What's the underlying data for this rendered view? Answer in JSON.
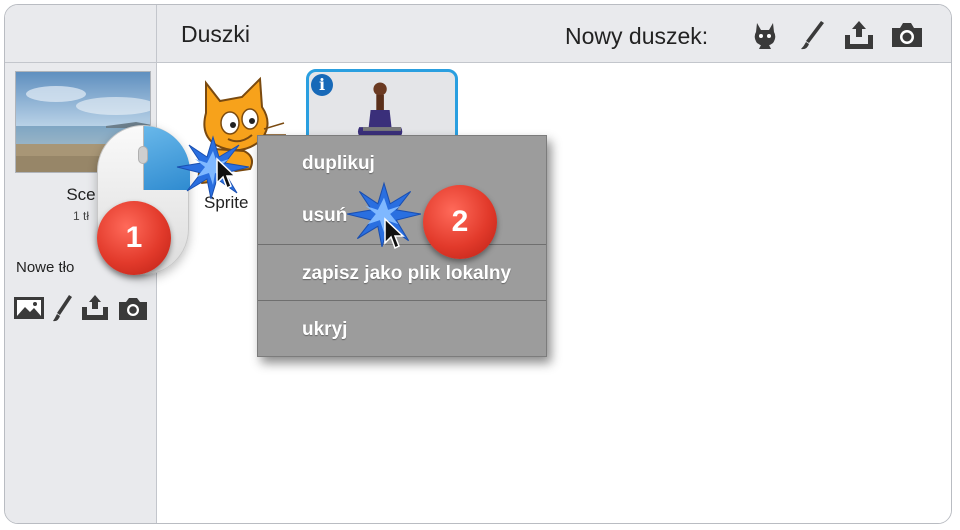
{
  "header": {
    "title": "Duszki",
    "new_sprite_label": "Nowy duszek:",
    "icons": [
      "choose-sprite-from-library-icon",
      "paint-new-sprite-icon",
      "upload-sprite-icon",
      "camera-icon"
    ]
  },
  "stage": {
    "name": "Sce",
    "sub": "1 tł",
    "new_backdrop_label": "Nowe tło",
    "icons": [
      "choose-backdrop-icon",
      "paint-backdrop-icon",
      "upload-backdrop-icon",
      "camera-backdrop-icon"
    ]
  },
  "sprites": [
    {
      "label": "Sprite",
      "icon": "scratch-cat-sprite",
      "selected": false
    },
    {
      "label": "",
      "icon": "person-sprite",
      "selected": true,
      "info": "i"
    }
  ],
  "context_menu": {
    "items": [
      "duplikuj",
      "usuń",
      "zapisz jako plik lokalny",
      "ukryj"
    ]
  },
  "annotations": {
    "step1": "1",
    "step2": "2"
  },
  "colors": {
    "accent": "#2a9fe0",
    "badge": "#e23a2b",
    "menu_bg": "#9c9c9c",
    "panel_bg": "#e9eaed"
  }
}
